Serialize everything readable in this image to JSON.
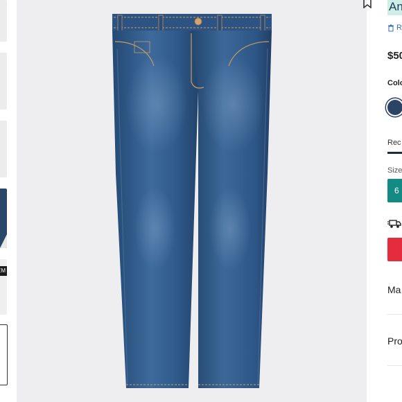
{
  "gallery": {
    "thumbnail_badge": "EM"
  },
  "product": {
    "title": "An",
    "remove_label": "R",
    "price": "$50",
    "color_label": "Colo",
    "color_swatch": "#2b4466",
    "tab_label": "Rec",
    "size_label": "Size",
    "selected_size": "6",
    "accordion": [
      "Ma",
      "Pro"
    ]
  },
  "colors": {
    "highlight": "#cfeee8",
    "size_button": "#138a84",
    "add_button": "#e52c3c",
    "link": "#2d6fb0",
    "denim": "#2f5787"
  },
  "icons": [
    "bookmark-icon",
    "trash-icon",
    "truck-icon"
  ]
}
